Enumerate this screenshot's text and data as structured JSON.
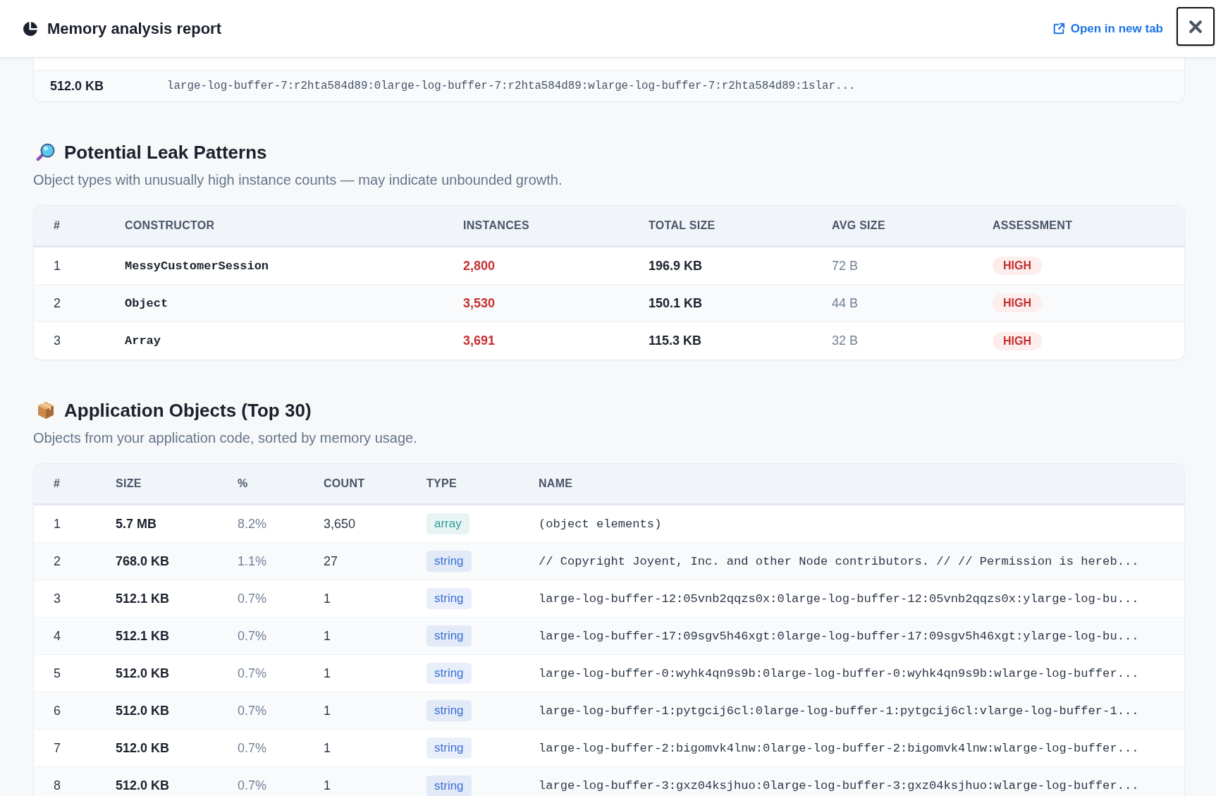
{
  "header": {
    "title": "Memory analysis report",
    "open_link": "Open in new tab"
  },
  "top_table": {
    "rows": [
      {
        "size": "512.0 KB",
        "name": "large-log-buffer-7:r2hta584d89:0large-log-buffer-7:r2hta584d89:wlarge-log-buffer-7:r2hta584d89:1slar..."
      }
    ]
  },
  "leak_section": {
    "title": "Potential Leak Patterns",
    "description": "Object types with unusually high instance counts — may indicate unbounded growth.",
    "table": {
      "columns": [
        "#",
        "CONSTRUCTOR",
        "INSTANCES",
        "TOTAL SIZE",
        "AVG SIZE",
        "ASSESSMENT"
      ],
      "rows": [
        {
          "index": "1",
          "constructor": "MessyCustomerSession",
          "instances": "2,800",
          "total_size": "196.9 KB",
          "avg_size": "72 B",
          "assessment": "HIGH"
        },
        {
          "index": "2",
          "constructor": "Object",
          "instances": "3,530",
          "total_size": "150.1 KB",
          "avg_size": "44 B",
          "assessment": "HIGH"
        },
        {
          "index": "3",
          "constructor": "Array",
          "instances": "3,691",
          "total_size": "115.3 KB",
          "avg_size": "32 B",
          "assessment": "HIGH"
        }
      ]
    }
  },
  "app_section": {
    "title": "Application Objects (Top 30)",
    "description": "Objects from your application code, sorted by memory usage.",
    "table": {
      "columns": [
        "#",
        "SIZE",
        "%",
        "COUNT",
        "TYPE",
        "NAME"
      ],
      "rows": [
        {
          "index": "1",
          "size": "5.7 MB",
          "percent": "8.2%",
          "count": "3,650",
          "type": "array",
          "color": "#2a9a9a",
          "name": "(object elements)"
        },
        {
          "index": "2",
          "size": "768.0 KB",
          "percent": "1.1%",
          "count": "27",
          "type": "string",
          "color": "#3b6fd6",
          "name": "// Copyright Joyent, Inc. and other Node contributors. // // Permission is hereb..."
        },
        {
          "index": "3",
          "size": "512.1 KB",
          "percent": "0.7%",
          "count": "1",
          "type": "string",
          "color": "#3b6fd6",
          "name": "large-log-buffer-12:05vnb2qqzs0x:0large-log-buffer-12:05vnb2qqzs0x:ylarge-log-bu..."
        },
        {
          "index": "4",
          "size": "512.1 KB",
          "percent": "0.7%",
          "count": "1",
          "type": "string",
          "color": "#3b6fd6",
          "name": "large-log-buffer-17:09sgv5h46xgt:0large-log-buffer-17:09sgv5h46xgt:ylarge-log-bu..."
        },
        {
          "index": "5",
          "size": "512.0 KB",
          "percent": "0.7%",
          "count": "1",
          "type": "string",
          "color": "#3b6fd6",
          "name": "large-log-buffer-0:wyhk4qn9s9b:0large-log-buffer-0:wyhk4qn9s9b:wlarge-log-buffer..."
        },
        {
          "index": "6",
          "size": "512.0 KB",
          "percent": "0.7%",
          "count": "1",
          "type": "string",
          "color": "#3b6fd6",
          "name": "large-log-buffer-1:pytgcij6cl:0large-log-buffer-1:pytgcij6cl:vlarge-log-buffer-1..."
        },
        {
          "index": "7",
          "size": "512.0 KB",
          "percent": "0.7%",
          "count": "1",
          "type": "string",
          "color": "#3b6fd6",
          "name": "large-log-buffer-2:bigomvk4lnw:0large-log-buffer-2:bigomvk4lnw:wlarge-log-buffer..."
        },
        {
          "index": "8",
          "size": "512.0 KB",
          "percent": "0.7%",
          "count": "1",
          "type": "string",
          "color": "#3b6fd6",
          "name": "large-log-buffer-3:gxz04ksjhuo:0large-log-buffer-3:gxz04ksjhuo:wlarge-log-buffer..."
        }
      ]
    }
  }
}
